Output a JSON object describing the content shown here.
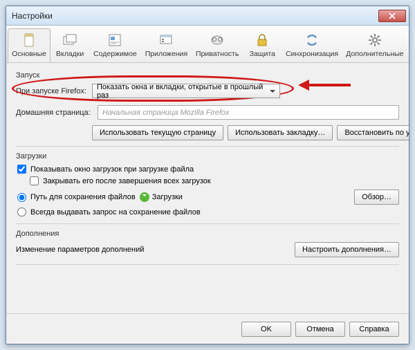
{
  "window": {
    "title": "Настройки"
  },
  "tabs": [
    {
      "label": "Основные",
      "icon": "general"
    },
    {
      "label": "Вкладки",
      "icon": "tabs"
    },
    {
      "label": "Содержимое",
      "icon": "content"
    },
    {
      "label": "Приложения",
      "icon": "apps"
    },
    {
      "label": "Приватность",
      "icon": "privacy"
    },
    {
      "label": "Защита",
      "icon": "security"
    },
    {
      "label": "Синхронизация",
      "icon": "sync"
    },
    {
      "label": "Дополнительные",
      "icon": "advanced"
    }
  ],
  "startup": {
    "section": "Запуск",
    "label": "При запуске Firefox:",
    "dropdown": "Показать окна и вкладки, открытые в прошлый раз",
    "homeLabel": "Домашняя страница:",
    "homeValue": "Начальная страница Mozilla Firefox",
    "btnCurrent": "Использовать текущую страницу",
    "btnBookmark": "Использовать закладку…",
    "btnRestore": "Восстановить по умолчанию"
  },
  "downloads": {
    "section": "Загрузки",
    "showWindow": "Показывать окно загрузок при загрузке файла",
    "closeAfter": "Закрывать его после завершения всех загрузок",
    "savePath": "Путь для сохранения файлов",
    "folder": "Загрузки",
    "browse": "Обзор…",
    "ask": "Всегда выдавать запрос на сохранение файлов"
  },
  "addons": {
    "section": "Дополнения",
    "desc": "Изменение параметров дополнений",
    "btn": "Настроить дополнения…"
  },
  "footer": {
    "ok": "OK",
    "cancel": "Отмена",
    "help": "Справка"
  }
}
